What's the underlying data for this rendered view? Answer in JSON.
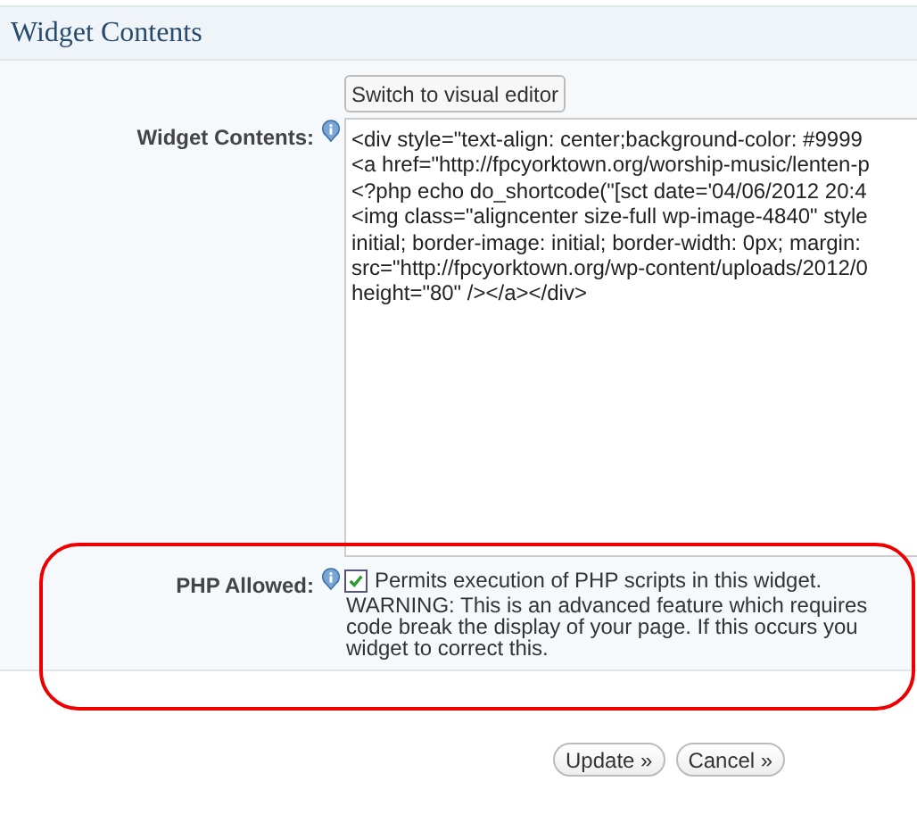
{
  "section": {
    "title": "Widget Contents"
  },
  "editor": {
    "switch_button": "Switch to visual editor",
    "label": "Widget Contents:",
    "lines": [
      "<div style=\"text-align: center;background-color: #9999",
      "<a href=\"http://fpcyorktown.org/worship-music/lenten-p",
      "<?php echo do_shortcode(\"[sct date='04/06/2012 20:4",
      "<img class=\"aligncenter size-full wp-image-4840\" style",
      "initial; border-image: initial; border-width: 0px; margin: ",
      "src=\"http://fpcyorktown.org/wp-content/uploads/2012/0",
      "height=\"80\" /></a></div>"
    ]
  },
  "php_allowed": {
    "label": "PHP Allowed:",
    "checked": true,
    "text": "Permits execution of PHP scripts in this widget.",
    "warning_lines": [
      "WARNING: This is an advanced feature which requires",
      "code break the display of your page. If this occurs you",
      "widget to correct this."
    ]
  },
  "buttons": [
    "Update »",
    "Cancel »"
  ]
}
